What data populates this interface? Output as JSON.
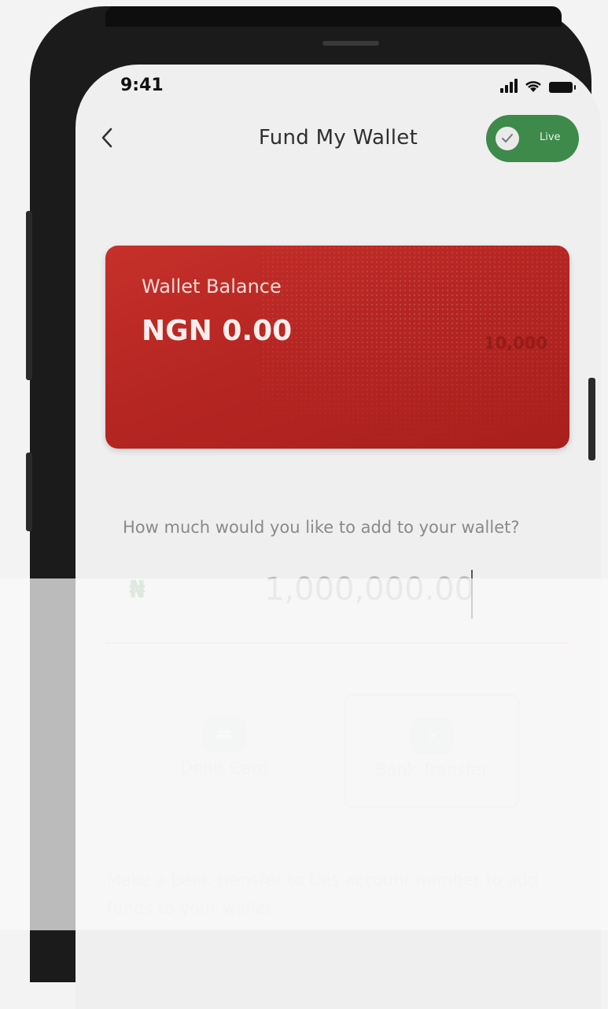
{
  "status_bar": {
    "time": "9:41"
  },
  "header": {
    "title": "Fund My Wallet",
    "live_label": "Live"
  },
  "wallet_card": {
    "label": "Wallet Balance",
    "balance": "NGN 0.00",
    "faint_amount": "10,000"
  },
  "amount": {
    "prompt": "How much would you like to add to your wallet?",
    "currency_symbol": "₦",
    "value": "1,000,000.00"
  },
  "methods": [
    {
      "label": "Debit Card",
      "icon": "card-icon"
    },
    {
      "label": "Bank Transfer",
      "icon": "transfer-icon"
    }
  ],
  "note": "Make a bank transfer to this account number to add funds to your wallet.",
  "colors": {
    "brand_red": "#b52622",
    "live_green": "#3d8a4a",
    "naira_green": "#93bf9b"
  }
}
